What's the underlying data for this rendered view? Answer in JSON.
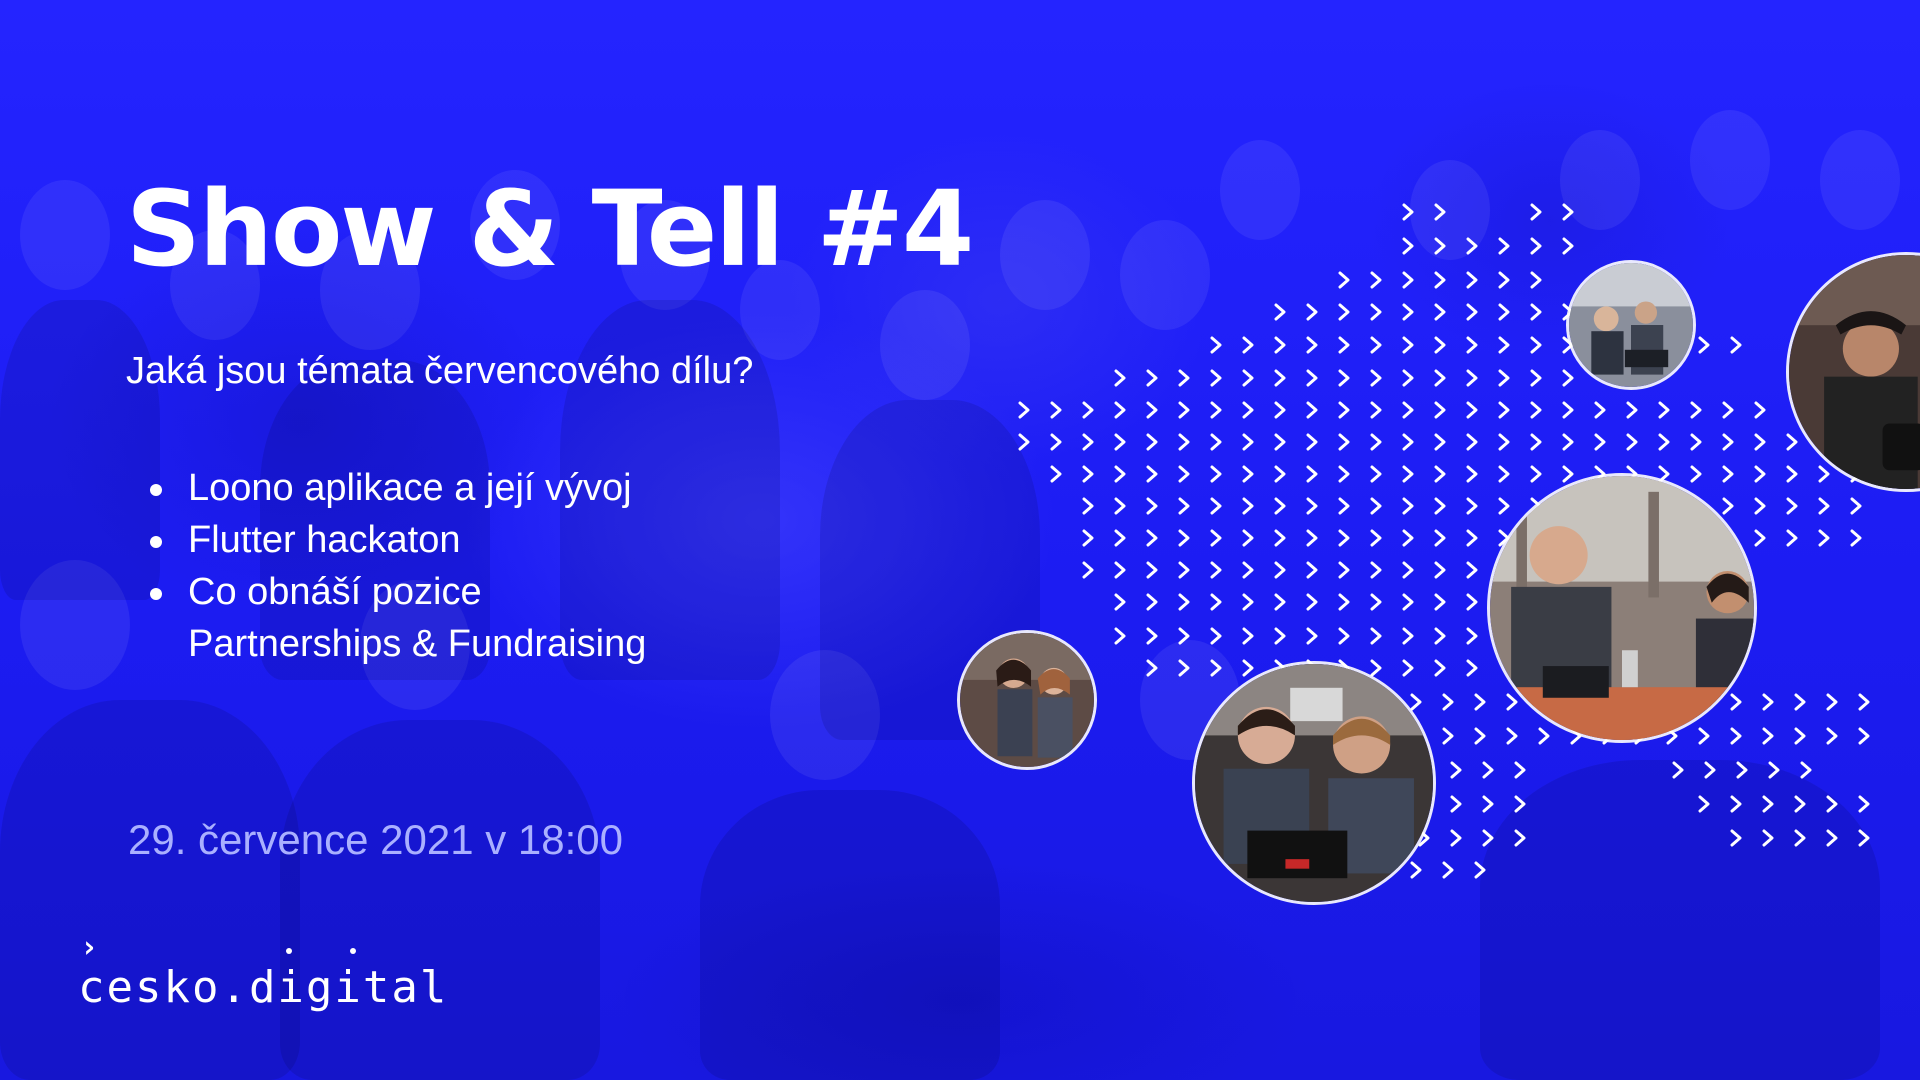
{
  "slide": {
    "title": "Show & Tell #4",
    "subtitle": "Jaká jsou témata červencového dílu?",
    "topics": [
      "Loono aplikace a její vývoj",
      "Flutter hackaton",
      "Co obnáší pozice",
      "Partnerships & Fundraising"
    ],
    "date": "29. července 2021 v 18:00"
  },
  "logo": {
    "text": "cesko.digital",
    "chevron": "›"
  },
  "colors": {
    "background": "#1f1fff",
    "text": "#ffffff",
    "date_text": "#aab0ff"
  },
  "icons": {
    "pattern": "chevron-right-icon",
    "logo": "cesko-digital-logo"
  }
}
